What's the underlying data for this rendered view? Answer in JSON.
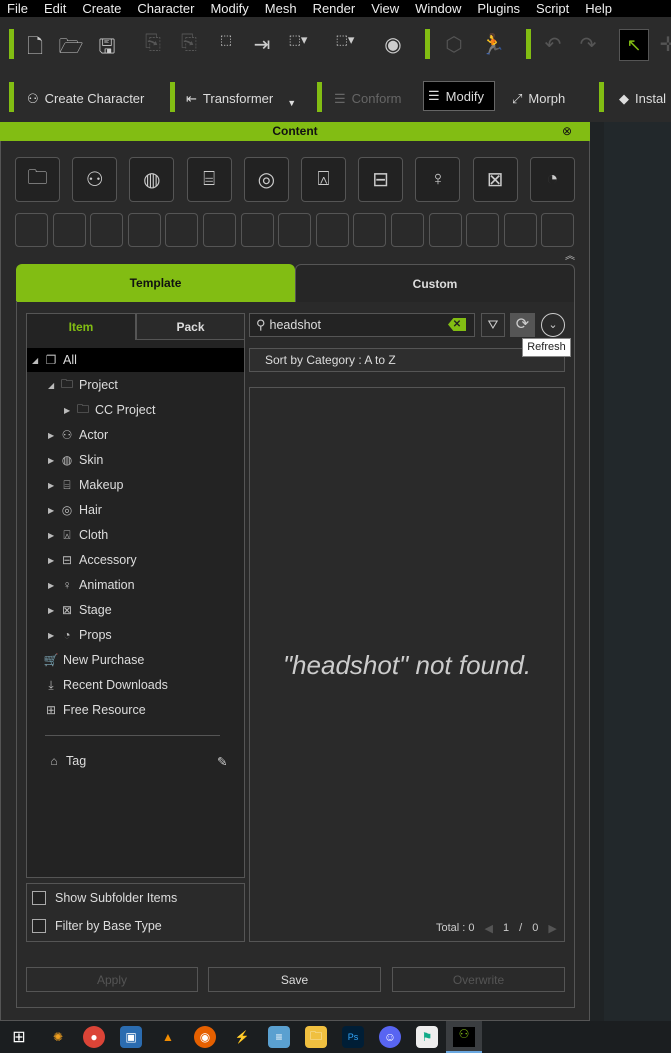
{
  "menu": [
    "File",
    "Edit",
    "Create",
    "Character",
    "Modify",
    "Mesh",
    "Render",
    "View",
    "Window",
    "Plugins",
    "Script",
    "Help"
  ],
  "toolbar2": {
    "create_character": "Create Character",
    "transformer": "Transformer",
    "conform": "Conform",
    "modify": "Modify",
    "morph": "Morph",
    "install": "Instal"
  },
  "content": {
    "title": "Content",
    "category_icons": [
      "folder-icon",
      "actor-icon",
      "skin-icon",
      "makeup-icon",
      "hair-icon",
      "cloth-icon",
      "accessory-icon",
      "animation-icon",
      "stage-icon",
      "props-icon"
    ],
    "tabs": {
      "template": "Template",
      "custom": "Custom"
    },
    "subtabs": {
      "item": "Item",
      "pack": "Pack"
    },
    "search": {
      "value": "headshot"
    },
    "tooltip": "Refresh",
    "sort": "Sort by Category : A to Z",
    "message": "\"headshot\" not found.",
    "tree": [
      {
        "label": "All",
        "level": 0,
        "arrow": "◢",
        "icon": "❐"
      },
      {
        "label": "Project",
        "level": 1,
        "arrow": "◢",
        "icon": "🗀"
      },
      {
        "label": "CC Project",
        "level": 2,
        "arrow": "▶",
        "icon": "🗀"
      },
      {
        "label": "Actor",
        "level": 1,
        "arrow": "▶",
        "icon": "⚇"
      },
      {
        "label": "Skin",
        "level": 1,
        "arrow": "▶",
        "icon": "◍"
      },
      {
        "label": "Makeup",
        "level": 1,
        "arrow": "▶",
        "icon": "⌸"
      },
      {
        "label": "Hair",
        "level": 1,
        "arrow": "▶",
        "icon": "◎"
      },
      {
        "label": "Cloth",
        "level": 1,
        "arrow": "▶",
        "icon": "⍓"
      },
      {
        "label": "Accessory",
        "level": 1,
        "arrow": "▶",
        "icon": "⊟"
      },
      {
        "label": "Animation",
        "level": 1,
        "arrow": "▶",
        "icon": "♀"
      },
      {
        "label": "Stage",
        "level": 1,
        "arrow": "▶",
        "icon": "⊠"
      },
      {
        "label": "Props",
        "level": 1,
        "arrow": "▶",
        "icon": "◔"
      },
      {
        "label": "New Purchase",
        "level": 0,
        "arrow": "",
        "icon": "🛒"
      },
      {
        "label": "Recent Downloads",
        "level": 0,
        "arrow": "",
        "icon": "⤓"
      },
      {
        "label": "Free Resource",
        "level": 0,
        "arrow": "",
        "icon": "⊞"
      }
    ],
    "tag": "Tag",
    "show_subfolder": "Show Subfolder Items",
    "filter_base": "Filter by Base Type",
    "total": "Total : 0",
    "page_current": "1",
    "page_sep": "/",
    "page_total": "0",
    "buttons": {
      "apply": "Apply",
      "save": "Save",
      "overwrite": "Overwrite"
    }
  },
  "colors": {
    "accent": "#82bd13"
  }
}
